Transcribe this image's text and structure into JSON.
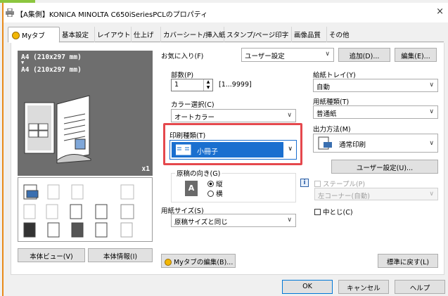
{
  "window": {
    "title": "【A集側】KONICA MINOLTA C650iSeriesPCLのプロパティ",
    "close_glyph": "×"
  },
  "tabs": [
    {
      "label": "Myタブ",
      "active": true
    },
    {
      "label": "基本設定"
    },
    {
      "label": "レイアウト"
    },
    {
      "label": "仕上げ"
    },
    {
      "label": "カバーシート/挿入紙"
    },
    {
      "label": "スタンプ/ページ印字"
    },
    {
      "label": "画像品質"
    },
    {
      "label": "その他"
    }
  ],
  "preview": {
    "paper_line1": "A4 (210x297 mm)",
    "arrow": "▼",
    "paper_line2": "A4 (210x297 mm)",
    "copies_badge": "x1"
  },
  "left_buttons": {
    "printer_view": "本体ビュー(V)",
    "printer_info": "本体情報(I)"
  },
  "favorites": {
    "label": "お気に入り(F)",
    "value": "ユーザー設定",
    "add": "追加(D)...",
    "edit": "編集(E)..."
  },
  "copies": {
    "label": "部数(P)",
    "value": "1",
    "range": "[1...9999]"
  },
  "color": {
    "label": "カラー選択(C)",
    "value": "オートカラー"
  },
  "print_type": {
    "label": "印刷種類(T)",
    "value": "小冊子"
  },
  "orientation": {
    "label": "原稿の向き(G)",
    "portrait": "縦",
    "landscape": "横"
  },
  "paper_size": {
    "label": "用紙サイズ(S)",
    "value": "原稿サイズと同じ"
  },
  "paper_tray": {
    "label": "給紙トレイ(Y)",
    "value": "自動"
  },
  "paper_type": {
    "label": "用紙種類(T)",
    "value": "普通紙"
  },
  "output": {
    "label": "出力方法(M)",
    "value": "通常印刷",
    "user_settings": "ユーザー設定(U)..."
  },
  "staple": {
    "label": "ステープル(P)",
    "value": "左コーナー(自動)"
  },
  "center_staple": {
    "label": "中とじ(C)"
  },
  "info_glyph": "i",
  "bottom": {
    "edit_my_tab": "Myタブの編集(B)...",
    "restore_defaults": "標準に戻す(L)"
  },
  "dialog_buttons": {
    "ok": "OK",
    "cancel": "キャンセル",
    "help": "ヘルプ"
  },
  "colors": {
    "highlight_red": "#e5484d",
    "selection_blue": "#1a6fcf",
    "preview_gray": "#6e6e6e",
    "window_border_orange": "#e88a1a"
  }
}
